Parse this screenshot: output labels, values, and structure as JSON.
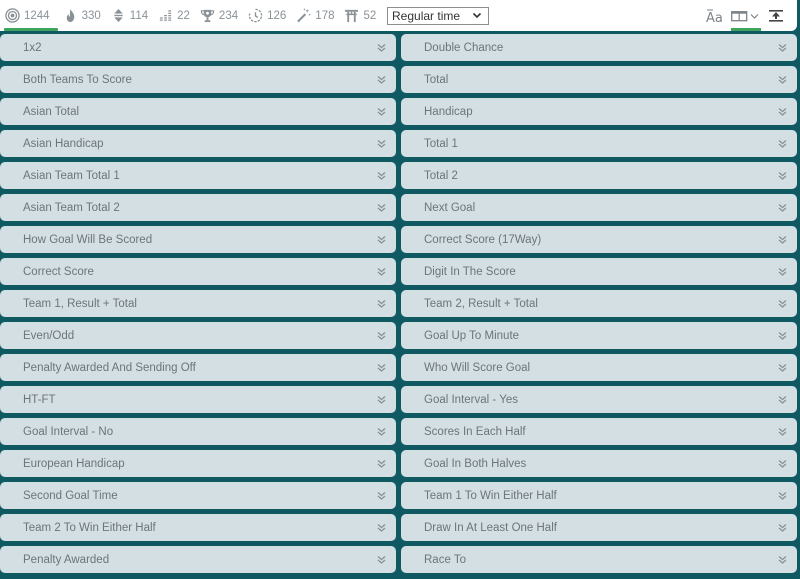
{
  "toolbar": {
    "filters": [
      {
        "icon": "target-icon",
        "count": "1244",
        "active": true
      },
      {
        "icon": "fire-icon",
        "count": "330"
      },
      {
        "icon": "up-down-arrows-icon",
        "count": "114"
      },
      {
        "icon": "bars-icon",
        "count": "22"
      },
      {
        "icon": "trophy-icon",
        "count": "234"
      },
      {
        "icon": "timer-icon",
        "count": "126"
      },
      {
        "icon": "magic-wand-icon",
        "count": "178"
      },
      {
        "icon": "torii-gate-icon",
        "count": "52"
      }
    ],
    "period_select": {
      "value": "Regular time"
    },
    "tools": [
      {
        "icon": "font-size-icon",
        "label": "Aa"
      },
      {
        "icon": "columns-layout-icon",
        "active": true
      },
      {
        "icon": "collapse-all-icon"
      }
    ]
  },
  "colors": {
    "background": "#0f5a62",
    "row_fill": "#d3dfe3",
    "accent_green": "#3da35d",
    "text": "#6e7479"
  },
  "markets": {
    "left": [
      "1x2",
      "Both Teams To Score",
      "Asian Total",
      "Asian Handicap",
      "Asian Team Total 1",
      "Asian Team Total 2",
      "How Goal Will Be Scored",
      "Correct Score",
      "Team 1, Result + Total",
      "Even/Odd",
      "Penalty Awarded And Sending Off",
      "HT-FT",
      "Goal Interval - No",
      "European Handicap",
      "Second Goal Time",
      "Team 2 To Win Either Half",
      "Penalty Awarded"
    ],
    "right": [
      "Double Chance",
      "Total",
      "Handicap",
      "Total 1",
      "Total 2",
      "Next Goal",
      "Correct Score (17Way)",
      "Digit In The Score",
      "Team 2, Result + Total",
      "Goal Up To Minute",
      "Who Will Score Goal",
      "Goal Interval - Yes",
      "Scores In Each Half",
      "Goal In Both Halves",
      "Team 1 To Win Either Half",
      "Draw In At Least One Half",
      "Race To"
    ]
  }
}
